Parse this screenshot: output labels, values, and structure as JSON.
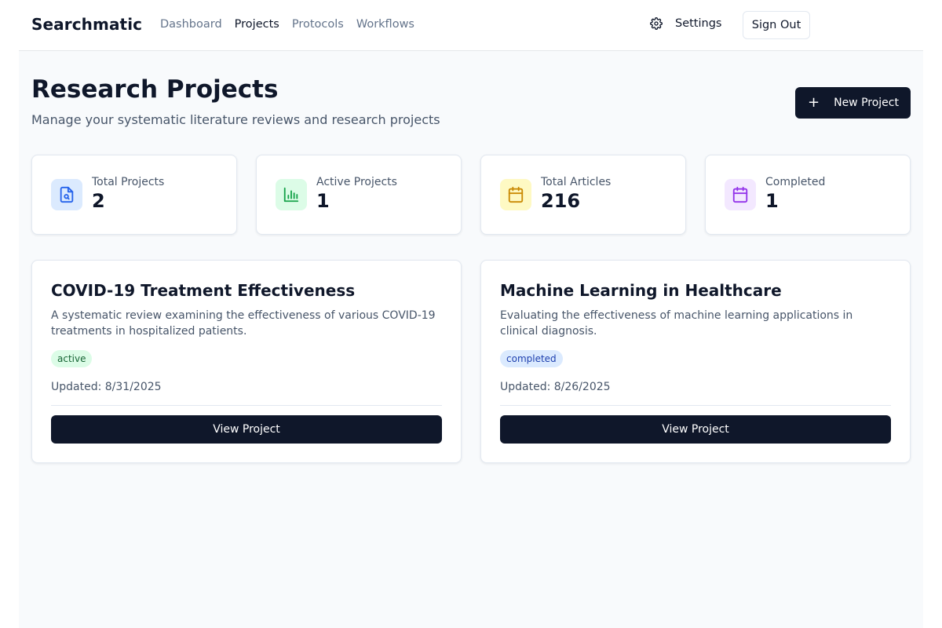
{
  "app": {
    "brand": "Searchmatic"
  },
  "nav": {
    "items": [
      {
        "label": "Dashboard"
      },
      {
        "label": "Projects"
      },
      {
        "label": "Protocols"
      },
      {
        "label": "Workflows"
      }
    ],
    "active": "Projects"
  },
  "header": {
    "settings_label": "Settings",
    "settings_icon": "gear-icon",
    "signout_label": "Sign Out"
  },
  "page": {
    "title": "Research Projects",
    "subtitle": "Manage your systematic literature reviews and research projects",
    "new_button_label": "New Project",
    "new_button_icon": "plus-icon"
  },
  "stats": [
    {
      "label": "Total Projects",
      "value": "2",
      "icon": "file-search-icon",
      "color": "#2563eb",
      "bg": "#dbeafe"
    },
    {
      "label": "Active Projects",
      "value": "1",
      "icon": "bar-chart-icon",
      "color": "#16a34a",
      "bg": "#dcfce7"
    },
    {
      "label": "Total Articles",
      "value": "216",
      "icon": "calendar-icon",
      "color": "#ca8a04",
      "bg": "#fef9c3"
    },
    {
      "label": "Completed",
      "value": "1",
      "icon": "calendar-icon",
      "color": "#9333ea",
      "bg": "#f3e8ff"
    }
  ],
  "projects": [
    {
      "title": "COVID-19 Treatment Effectiveness",
      "description": "A systematic review examining the effectiveness of various COVID-19 treatments in hospitalized patients.",
      "status": "active",
      "updated": "Updated: 8/31/2025",
      "button_label": "View Project"
    },
    {
      "title": "Machine Learning in Healthcare",
      "description": "Evaluating the effectiveness of machine learning applications in clinical diagnosis.",
      "status": "completed",
      "updated": "Updated: 8/26/2025",
      "button_label": "View Project"
    }
  ]
}
